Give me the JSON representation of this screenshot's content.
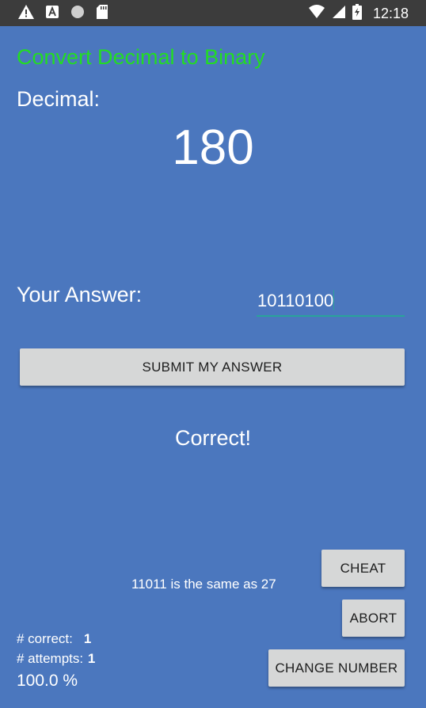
{
  "status_bar": {
    "time": "12:18",
    "left_icons": [
      "warning-icon",
      "app-a-icon",
      "circle-icon",
      "sd-card-icon"
    ],
    "right_icons": [
      "wifi-icon",
      "signal-icon",
      "battery-charging-icon"
    ]
  },
  "app": {
    "title": "Convert Decimal to Binary",
    "decimal_label": "Decimal:",
    "decimal_value": "180",
    "answer_label": "Your Answer:",
    "answer_value": "10110100",
    "submit_label": "SUBMIT MY ANSWER",
    "result_text": "Correct!",
    "hint_text": "11011 is the same as 27",
    "cheat_label": "CHEAT",
    "abort_label": "ABORT",
    "change_label": "CHANGE NUMBER",
    "stats": {
      "correct_label": "# correct:",
      "correct_value": "1",
      "attempts_label": "# attempts:",
      "attempts_value": "1",
      "percent": "100.0 %"
    }
  },
  "colors": {
    "background": "#4b77be",
    "title": "#22dd22",
    "button": "#d6d7d7",
    "input_underline": "#2aa39a"
  }
}
